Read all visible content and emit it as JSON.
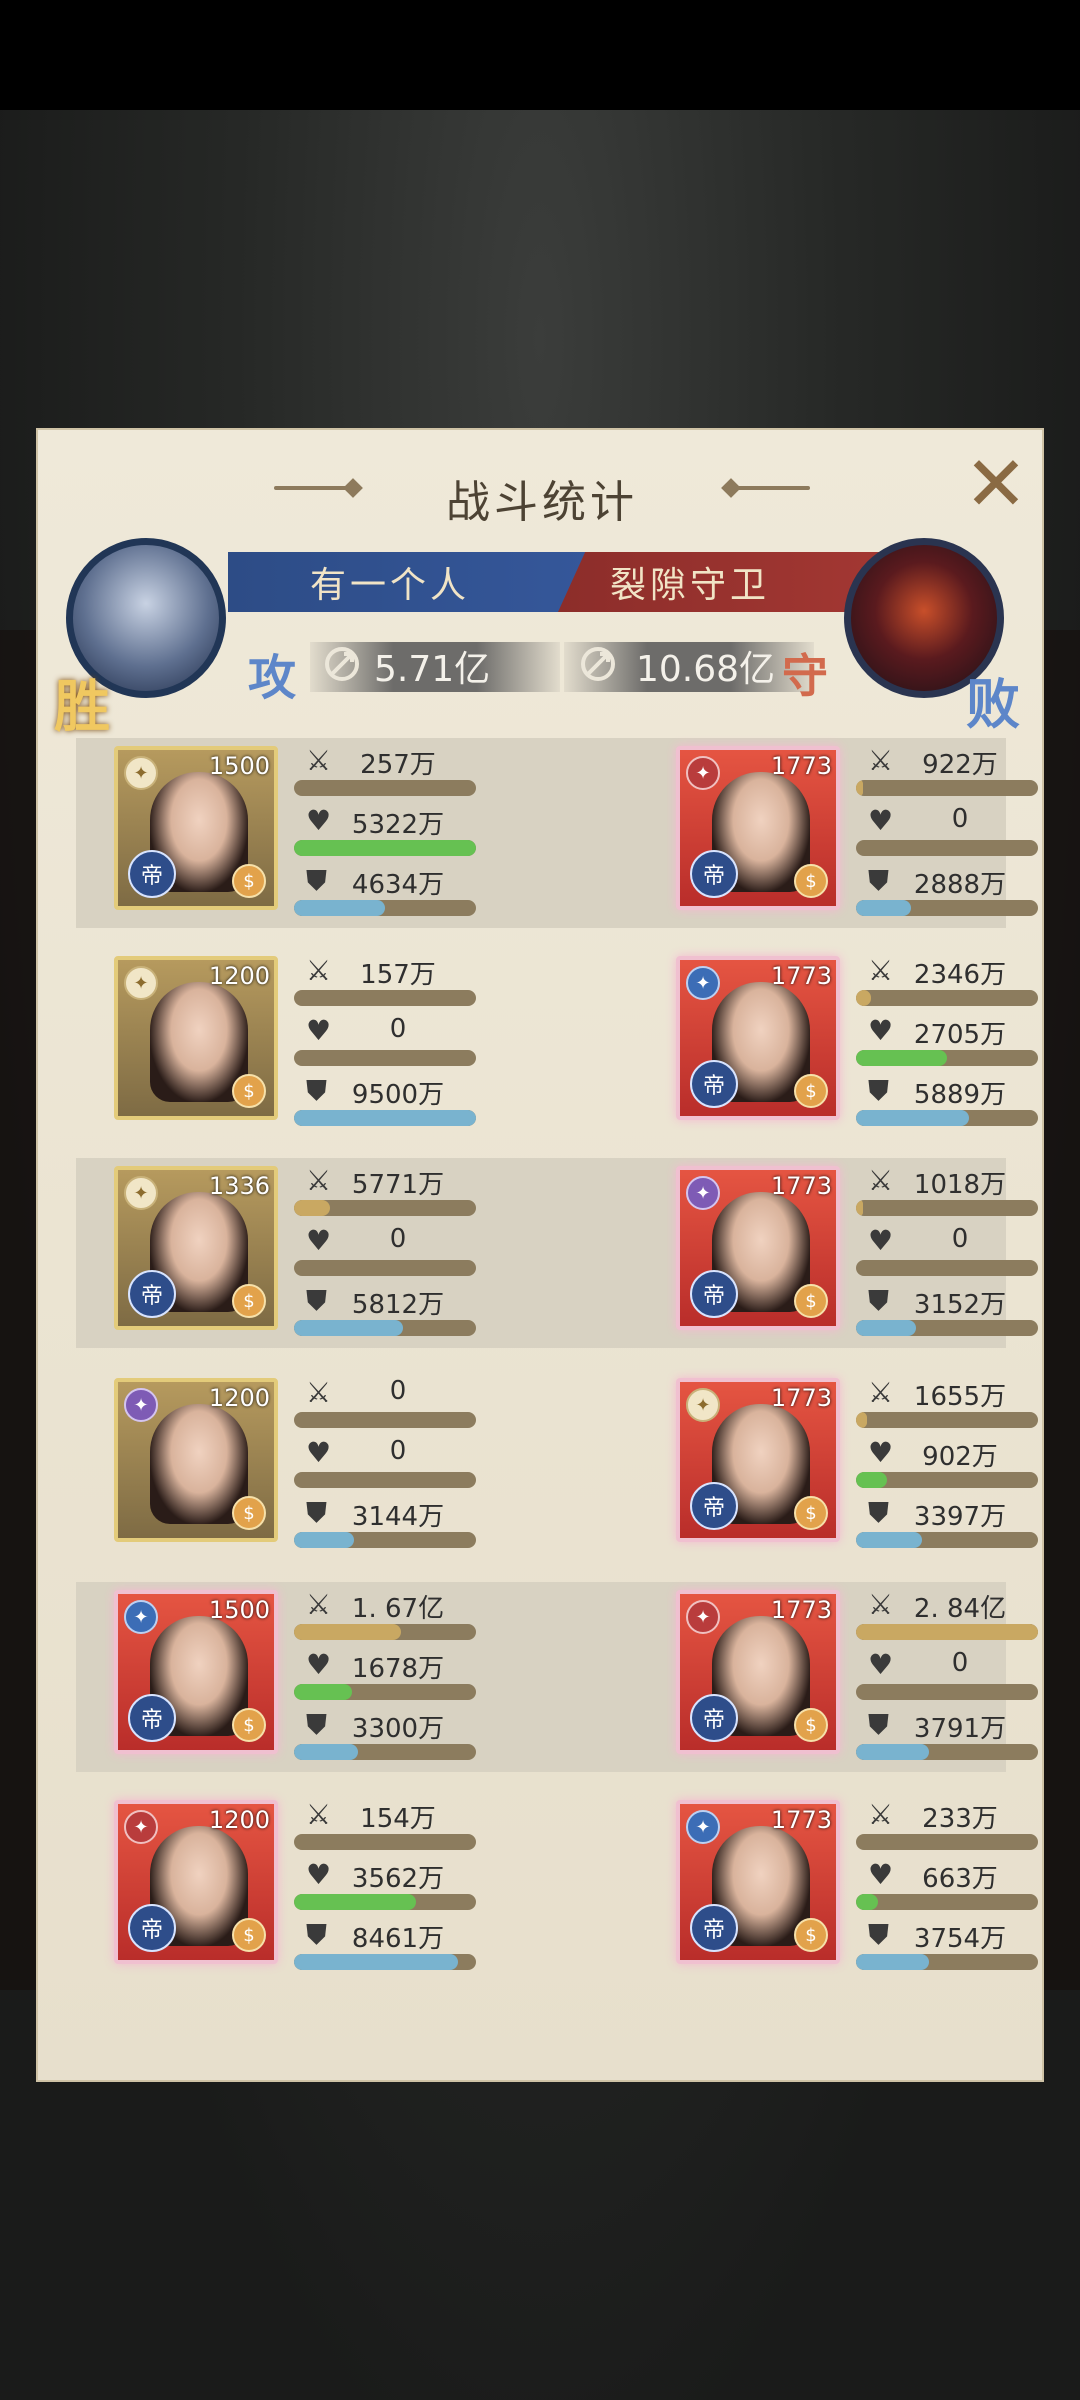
{
  "panel": {
    "title": "战斗统计",
    "close_label": "✕"
  },
  "teams": {
    "left": {
      "name": "有一个人",
      "power": "5.71亿",
      "badge_result": "胜",
      "badge_role": "攻"
    },
    "right": {
      "name": "裂隙守卫",
      "power": "10.68亿",
      "badge_result": "败",
      "badge_role": "守"
    }
  },
  "rows": [
    {
      "left": {
        "level": "1500",
        "atk": "257万",
        "hp": "5322万",
        "def": "4634万",
        "atk_pct": 0,
        "hp_pct": 100,
        "def_pct": 50
      },
      "right": {
        "level": "1773",
        "atk": "922万",
        "hp": "0",
        "def": "2888万",
        "atk_pct": 4,
        "hp_pct": 0,
        "def_pct": 30
      }
    },
    {
      "left": {
        "level": "1200",
        "atk": "157万",
        "hp": "0",
        "def": "9500万",
        "atk_pct": 0,
        "hp_pct": 0,
        "def_pct": 100
      },
      "right": {
        "level": "1773",
        "atk": "2346万",
        "hp": "2705万",
        "def": "5889万",
        "atk_pct": 8,
        "hp_pct": 50,
        "def_pct": 62
      }
    },
    {
      "left": {
        "level": "1336",
        "atk": "5771万",
        "hp": "0",
        "def": "5812万",
        "atk_pct": 20,
        "hp_pct": 0,
        "def_pct": 60
      },
      "right": {
        "level": "1773",
        "atk": "1018万",
        "hp": "0",
        "def": "3152万",
        "atk_pct": 4,
        "hp_pct": 0,
        "def_pct": 33
      }
    },
    {
      "left": {
        "level": "1200",
        "atk": "0",
        "hp": "0",
        "def": "3144万",
        "atk_pct": 0,
        "hp_pct": 0,
        "def_pct": 33
      },
      "right": {
        "level": "1773",
        "atk": "1655万",
        "hp": "902万",
        "def": "3397万",
        "atk_pct": 6,
        "hp_pct": 17,
        "def_pct": 36
      }
    },
    {
      "left": {
        "level": "1500",
        "atk": "1. 67亿",
        "hp": "1678万",
        "def": "3300万",
        "atk_pct": 59,
        "hp_pct": 32,
        "def_pct": 35
      },
      "right": {
        "level": "1773",
        "atk": "2. 84亿",
        "hp": "0",
        "def": "3791万",
        "atk_pct": 100,
        "hp_pct": 0,
        "def_pct": 40
      }
    },
    {
      "left": {
        "level": "1200",
        "atk": "154万",
        "hp": "3562万",
        "def": "8461万",
        "atk_pct": 0,
        "hp_pct": 67,
        "def_pct": 90
      },
      "right": {
        "level": "1773",
        "atk": "233万",
        "hp": "663万",
        "def": "3754万",
        "atk_pct": 0,
        "hp_pct": 12,
        "def_pct": 40
      }
    }
  ],
  "icons": {
    "attack": "sword-icon",
    "health": "heart-icon",
    "defense": "shield-icon",
    "power": "power-icon",
    "rank_glyph": "帝",
    "coin_glyph": "$"
  },
  "colors": {
    "attack_bar": "#c9a862",
    "health_bar": "#66c152",
    "defense_bar": "#79b3cf",
    "left_banner": "#2d4c86",
    "right_banner": "#8c2d2a"
  }
}
